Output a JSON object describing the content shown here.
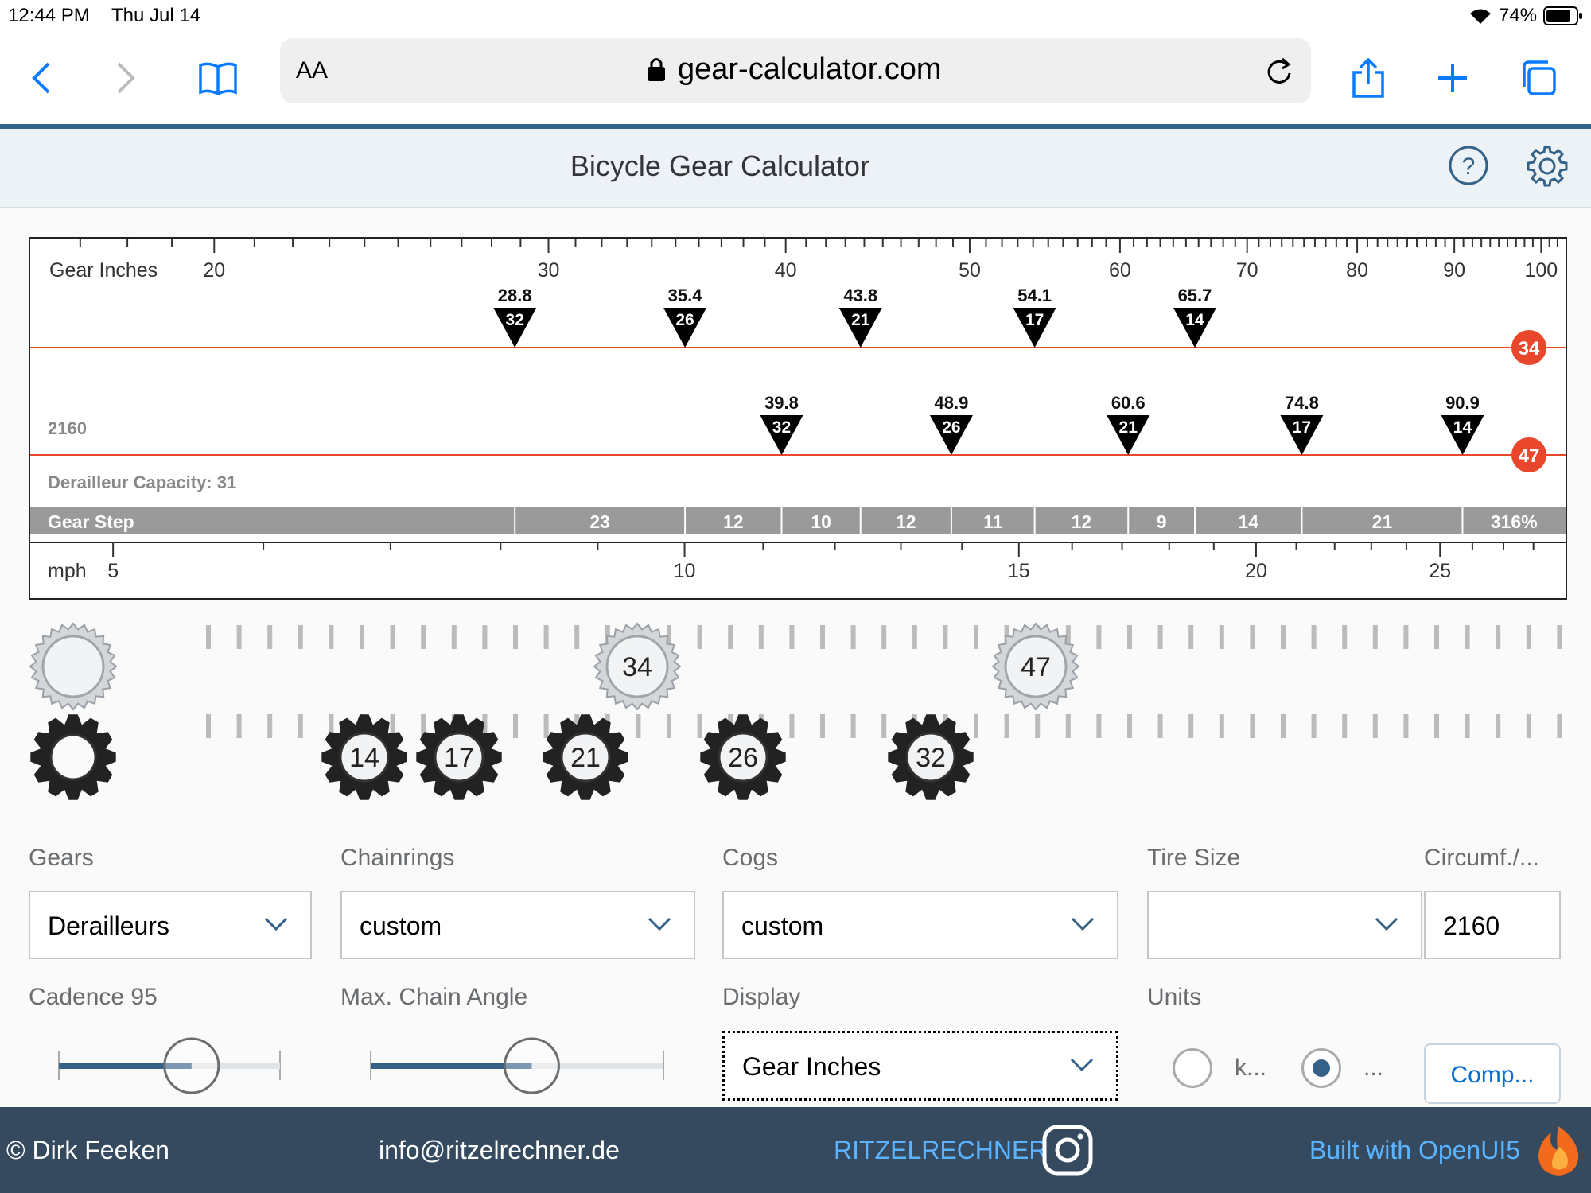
{
  "status_bar": {
    "time": "12:44 PM",
    "date": "Thu Jul 14",
    "battery": "74%"
  },
  "browser": {
    "aa_label": "AA",
    "url": "gear-calculator.com"
  },
  "app": {
    "title": "Bicycle Gear Calculator"
  },
  "chart_data": {
    "type": "scatter",
    "axis_top": {
      "label": "Gear Inches",
      "ticks": [
        "20",
        "30",
        "40",
        "50",
        "60",
        "70",
        "80",
        "90",
        "100"
      ],
      "range": [
        16,
        103
      ],
      "scale": "log"
    },
    "axis_bottom": {
      "label": "mph",
      "ticks": [
        "5",
        "10",
        "15",
        "20",
        "25"
      ]
    },
    "circumference_label": "2160",
    "capacity_label": "Derailleur Capacity: 31",
    "gear_step_label": "Gear Step",
    "series": [
      {
        "chainring": "34",
        "points": [
          {
            "cog": "32",
            "value": 28.8,
            "label": "28.8"
          },
          {
            "cog": "26",
            "value": 35.4,
            "label": "35.4"
          },
          {
            "cog": "21",
            "value": 43.8,
            "label": "43.8"
          },
          {
            "cog": "17",
            "value": 54.1,
            "label": "54.1"
          },
          {
            "cog": "14",
            "value": 65.7,
            "label": "65.7"
          }
        ]
      },
      {
        "chainring": "47",
        "points": [
          {
            "cog": "32",
            "value": 39.8,
            "label": "39.8"
          },
          {
            "cog": "26",
            "value": 48.9,
            "label": "48.9"
          },
          {
            "cog": "21",
            "value": 60.6,
            "label": "60.6"
          },
          {
            "cog": "17",
            "value": 74.8,
            "label": "74.8"
          },
          {
            "cog": "14",
            "value": 90.9,
            "label": "90.9"
          }
        ]
      }
    ],
    "gear_steps": [
      "23",
      "12",
      "10",
      "12",
      "11",
      "12",
      "9",
      "14",
      "21",
      "316%"
    ]
  },
  "sprockets": {
    "chainrings": [
      "34",
      "47"
    ],
    "cogs": [
      "14",
      "17",
      "21",
      "26",
      "32"
    ]
  },
  "form": {
    "gears": {
      "label": "Gears",
      "value": "Derailleurs"
    },
    "chainrings": {
      "label": "Chainrings",
      "value": "custom"
    },
    "cogs": {
      "label": "Cogs",
      "value": "custom"
    },
    "tire_size": {
      "label": "Tire Size",
      "value": ""
    },
    "circumference": {
      "label": "Circumf./...",
      "value": "2160"
    },
    "cadence": {
      "label": "Cadence 95",
      "fill": 0.6
    },
    "chain_angle": {
      "label": "Max. Chain Angle",
      "fill": 0.55
    },
    "display": {
      "label": "Display",
      "value": "Gear Inches"
    },
    "units": {
      "label": "Units",
      "option1": "k...",
      "option2": "...",
      "selected": 2
    },
    "compare_button": "Comp..."
  },
  "footer": {
    "copyright": "© Dirk Feeken",
    "email": "info@ritzelrechner.de",
    "brand": "RITZELRECHNER",
    "built_with": "Built with OpenUI5"
  },
  "colors": {
    "accent": "#346187",
    "chainring_badge": "#e8472b",
    "line": "#e8472b",
    "footer_bg": "#354a5f",
    "link": "#5cb3ff"
  }
}
